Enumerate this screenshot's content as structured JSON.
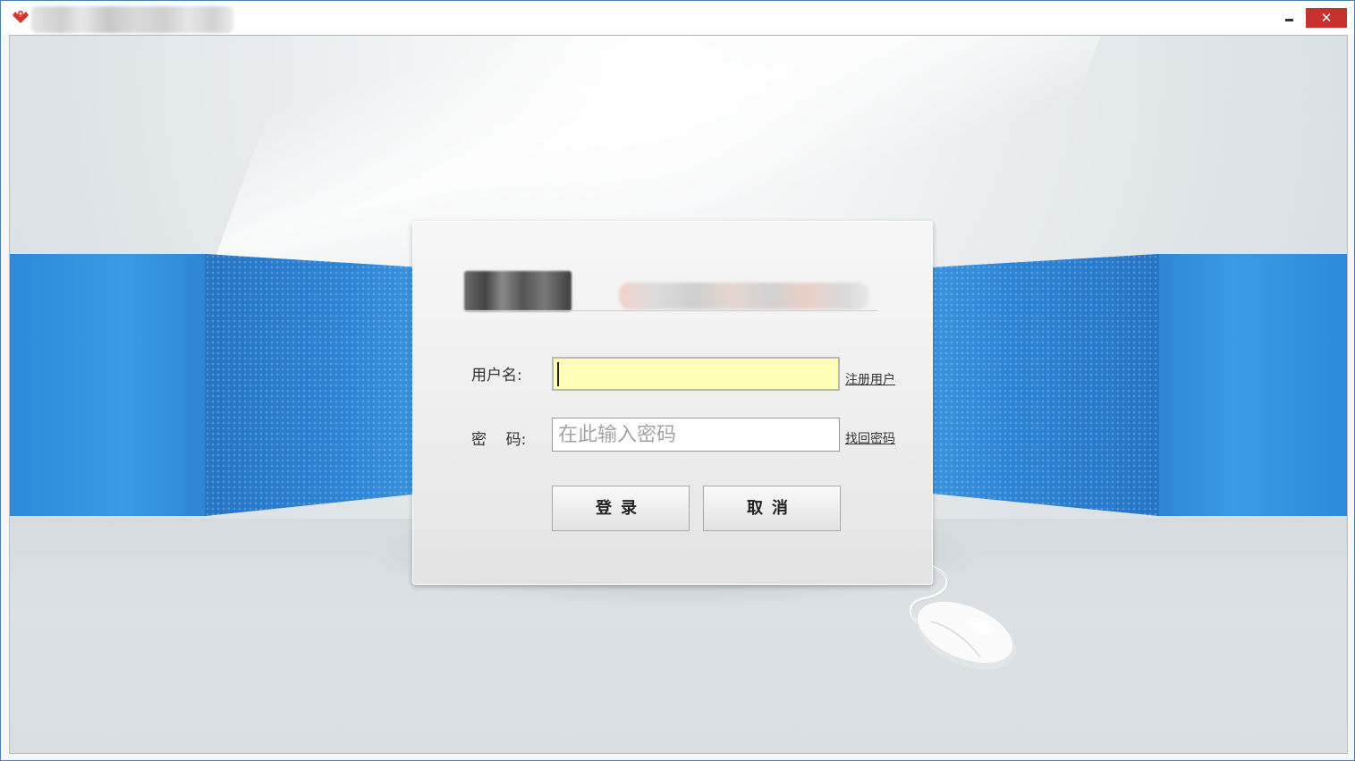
{
  "window": {
    "minimize_glyph": "",
    "close_glyph": "✕"
  },
  "login": {
    "username_label": "用户名:",
    "username_value": "",
    "password_label": "密    码:",
    "password_placeholder": "在此输入密码",
    "register_link": "注册用户",
    "recover_link": "找回密码",
    "login_button": "登录",
    "cancel_button": "取消"
  },
  "icons": {
    "app_logo": "app-logo-icon",
    "mouse": "computer-mouse-illustration"
  },
  "colors": {
    "accent_blue": "#2f86d6",
    "close_red": "#c7312d",
    "username_bg": "#fefeb9"
  }
}
